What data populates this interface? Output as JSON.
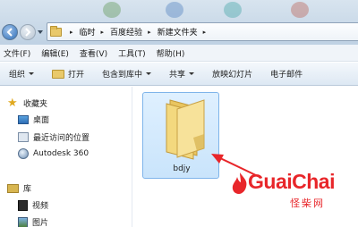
{
  "address": {
    "crumbs": [
      "临时",
      "百度经验",
      "新建文件夹"
    ],
    "separator": "▸"
  },
  "menubar": {
    "items": [
      "文件(F)",
      "编辑(E)",
      "查看(V)",
      "工具(T)",
      "帮助(H)"
    ]
  },
  "toolbar": {
    "organize": "组织",
    "open": "打开",
    "include_in_library": "包含到库中",
    "share": "共享",
    "slideshow": "放映幻灯片",
    "email": "电子邮件"
  },
  "sidebar": {
    "favorites": "收藏夹",
    "desktop": "桌面",
    "recent": "最近访问的位置",
    "autodesk": "Autodesk 360",
    "libraries": "库",
    "videos": "视频",
    "pictures": "图片"
  },
  "main": {
    "folder_name": "bdjy"
  },
  "watermark": {
    "brand": "GuaiChai",
    "sub": "怪柴网",
    "color": "#e8262a"
  },
  "icons": {
    "back": "back-arrow-icon",
    "forward": "forward-arrow-icon",
    "favorites": "star-icon",
    "desktop": "desktop-icon",
    "recent": "recent-places-icon",
    "autodesk": "autodesk-icon",
    "libraries": "library-icon",
    "videos": "video-icon",
    "pictures": "picture-icon",
    "folder": "folder-icon"
  }
}
